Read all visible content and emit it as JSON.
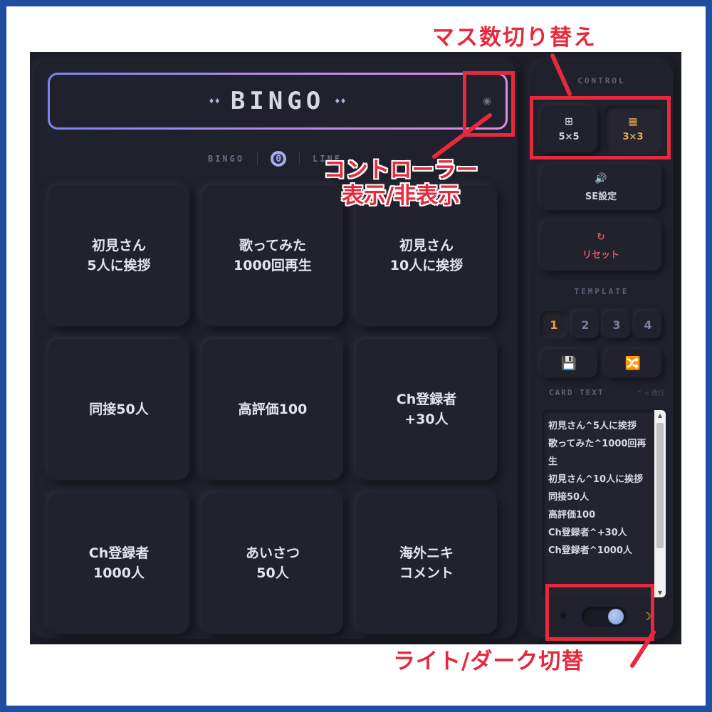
{
  "board": {
    "title": "BINGO",
    "title_deco_left": "♦♦",
    "title_deco_right": "♦♦",
    "eye_icon": "◉",
    "status_bingo_label": "BINGO",
    "status_count": "0",
    "status_line_label": "LINE",
    "cells": [
      "初見さん\n5人に挨拶",
      "歌ってみた\n1000回再生",
      "初見さん\n10人に挨拶",
      "同接50人",
      "高評価100",
      "Ch登録者\n+30人",
      "Ch登録者\n1000人",
      "あいさつ\n50人",
      "海外ニキ\nコメント"
    ]
  },
  "control": {
    "section_label": "CONTROL",
    "grid5_icon": "⊞",
    "grid5_label": "5×5",
    "grid3_icon": "▦",
    "grid3_label": "3×3",
    "se_icon": "🔊",
    "se_label": "SE設定",
    "reset_icon": "↻",
    "reset_label": "リセット",
    "template_label": "TEMPLATE",
    "templates": [
      "1",
      "2",
      "3",
      "4"
    ],
    "save_icon": "💾",
    "shuffle_icon": "🔀",
    "card_text_label": "CARD TEXT",
    "card_text_hint": "^ = 改行",
    "card_text_value": "初見さん^5人に挨拶\n歌ってみた^1000回再生\n初見さん^10人に挨拶\n同接50人\n高評価100\nCh登録者^+30人\nCh登録者^1000人",
    "sun_icon": "✹",
    "moon_icon": "☽"
  },
  "annotations": {
    "grid_switch": "マス数切り替え",
    "controller_toggle_line1": "コントローラー",
    "controller_toggle_line2": "表示/非表示",
    "theme_switch": "ライト/ダーク切替"
  },
  "colors": {
    "annotation_red": "#e8283c",
    "frame_blue": "#1f4da1",
    "accent_orange": "#e2a94a",
    "reset_red": "#e25669"
  }
}
